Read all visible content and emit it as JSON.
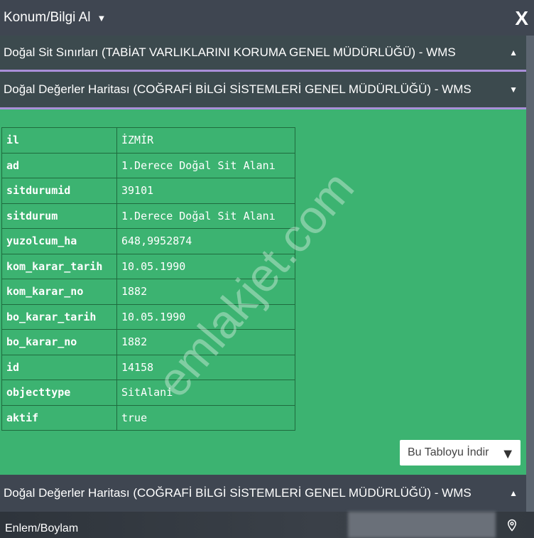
{
  "header": {
    "title": "Konum/Bilgi Al",
    "close": "X"
  },
  "sections": [
    {
      "title": "Doğal Sit Sınırları (TABİAT VARLIKLARINI KORUMA GENEL MÜDÜRLÜĞÜ) - WMS",
      "state": "expanded"
    },
    {
      "title": "Doğal Değerler Haritası (COĞRAFİ BİLGİ SİSTEMLERİ GENEL MÜDÜRLÜĞÜ) - WMS",
      "state": "collapsed"
    },
    {
      "title": "Doğal Değerler Haritası (COĞRAFİ BİLGİ SİSTEMLERİ GENEL MÜDÜRLÜĞÜ) - WMS",
      "state": "expanded"
    }
  ],
  "table": [
    {
      "k": "il",
      "v": "İZMİR"
    },
    {
      "k": "ad",
      "v": "1.Derece Doğal Sit Alanı"
    },
    {
      "k": "sitdurumid",
      "v": "39101"
    },
    {
      "k": "sitdurum",
      "v": "1.Derece Doğal Sit Alanı"
    },
    {
      "k": "yuzolcum_ha",
      "v": "648,9952874"
    },
    {
      "k": "kom_karar_tarih",
      "v": "10.05.1990"
    },
    {
      "k": "kom_karar_no",
      "v": "1882"
    },
    {
      "k": "bo_karar_tarih",
      "v": "10.05.1990"
    },
    {
      "k": "bo_karar_no",
      "v": "1882"
    },
    {
      "k": "id",
      "v": "14158"
    },
    {
      "k": "objecttype",
      "v": "SitAlani"
    },
    {
      "k": "aktif",
      "v": "true"
    }
  ],
  "download_label": "Bu Tabloyu İndir",
  "watermark": "emlakjet.com",
  "footer": {
    "label": "Enlem/Boylam"
  },
  "colors": {
    "panel": "#3f4651",
    "green": "#3cb371",
    "accent": "#a98fd8"
  }
}
